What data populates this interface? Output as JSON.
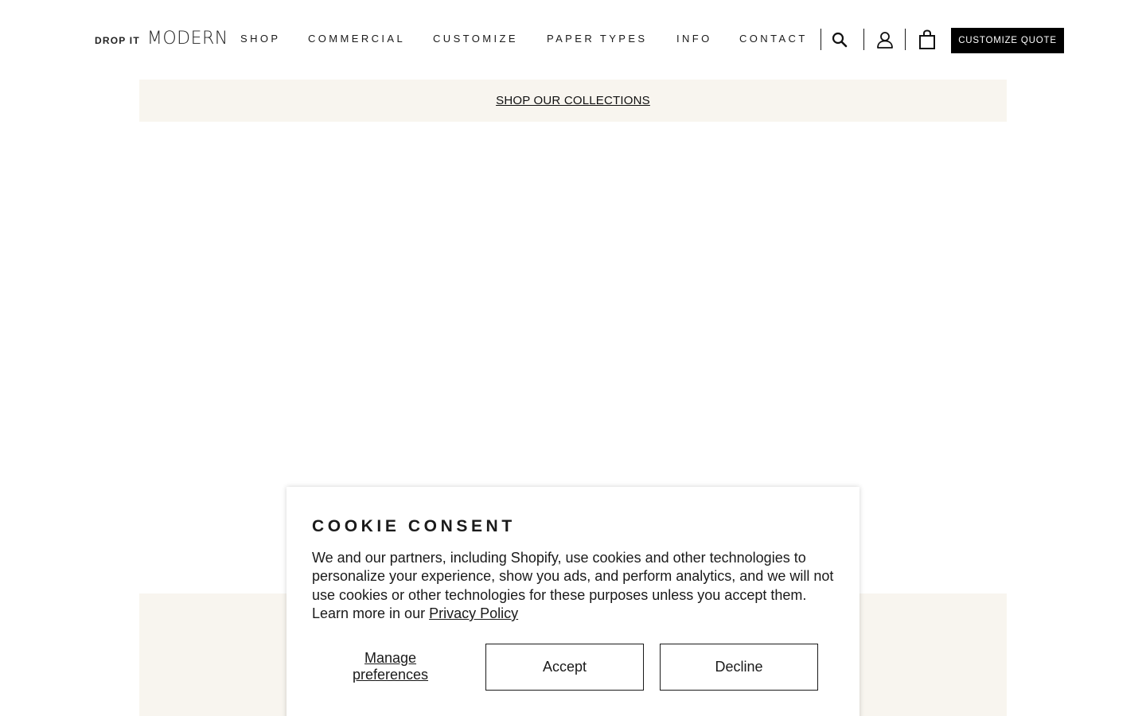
{
  "header": {
    "logo_small": "DROP IT",
    "logo_big": "MODERN",
    "nav": {
      "shop": "SHOP",
      "commercial": "COMMERCIAL",
      "customize": "CUSTOMIZE",
      "paper_types": "PAPER TYPES",
      "info": "INFO",
      "contact": "CONTACT"
    },
    "icons": [
      "search-icon",
      "account-icon",
      "shopping-bag-icon"
    ],
    "quote_button": "CUSTOMIZE QUOTE"
  },
  "banner": {
    "link": "SHOP OUR COLLECTIONS",
    "background": "#f8f5ef"
  },
  "cookie": {
    "title": "COOKIE CONSENT",
    "body": "We and our partners, including Shopify, use cookies and other technologies to personalize your experience, show you ads, and perform analytics, and we will not use cookies or other technologies for these purposes unless you accept them. Learn more in our ",
    "privacy_link": "Privacy Policy",
    "manage": "Manage preferences",
    "accept": "Accept",
    "decline": "Decline"
  },
  "colors": {
    "accent": "#000000",
    "beige": "#f8f5ef",
    "text": "#1a1a1a"
  }
}
